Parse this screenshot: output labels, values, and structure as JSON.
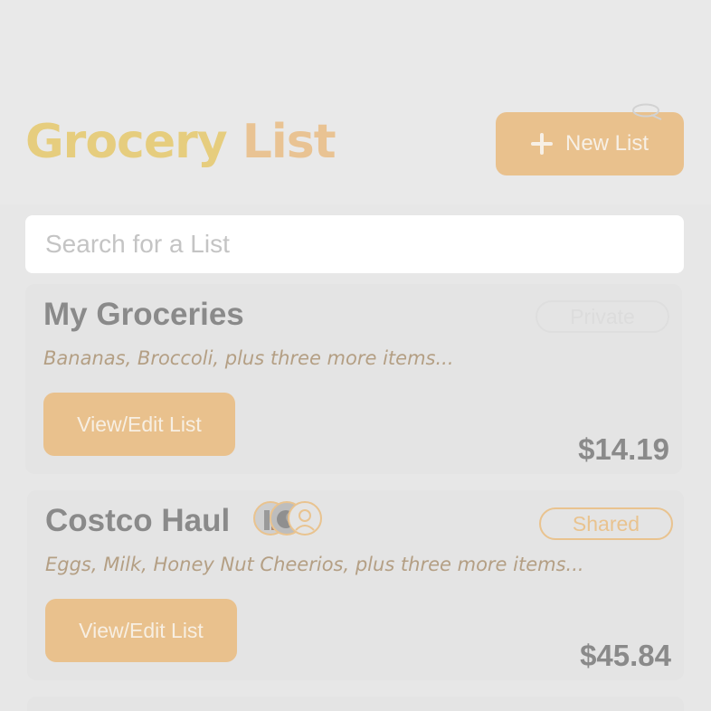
{
  "header": {
    "title_word1": "Grocery",
    "title_word2": "List",
    "new_list_label": "New List",
    "title_color_1": "#e6cd7e",
    "title_color_2": "#e9c393",
    "accent": "#e9c18d"
  },
  "search": {
    "placeholder": "Search for a List"
  },
  "lists": [
    {
      "title": "My Groceries",
      "visibility": "Private",
      "items_summary": "Bananas, Broccoli, plus three more items...",
      "action_label": "View/Edit List",
      "total": "$14.19"
    },
    {
      "title": "Costco Haul",
      "visibility": "Shared",
      "items_summary": "Eggs, Milk, Honey Nut Cheerios, plus three more items...",
      "action_label": "View/Edit List",
      "total": "$45.84",
      "member_icons": [
        "user-avatar-icon",
        "user-avatar-icon",
        "user-avatar-icon"
      ]
    }
  ],
  "icons": {
    "new_list": "plus-icon",
    "chat": "chat-bubble-icon"
  }
}
